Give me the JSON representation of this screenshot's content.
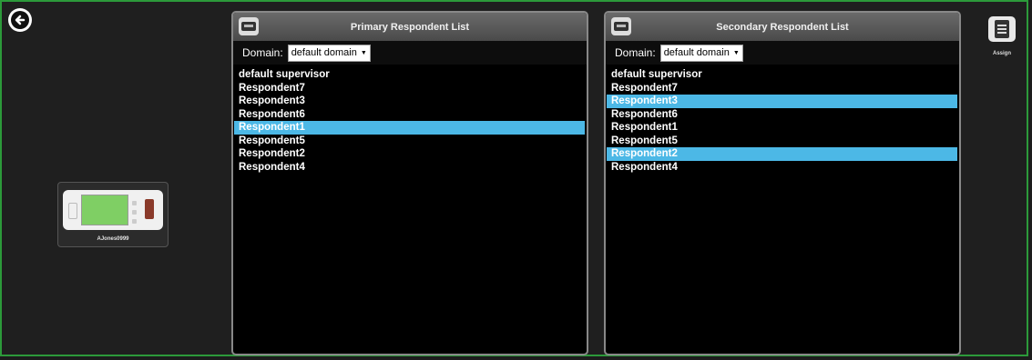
{
  "device": {
    "label": "AJones0999"
  },
  "primary_panel": {
    "title": "Primary Respondent List",
    "domain_label": "Domain:",
    "domain_value": "default domain",
    "items": [
      {
        "label": "default supervisor",
        "selected": false
      },
      {
        "label": "Respondent7",
        "selected": false
      },
      {
        "label": "Respondent3",
        "selected": false
      },
      {
        "label": "Respondent6",
        "selected": false
      },
      {
        "label": "Respondent1",
        "selected": true
      },
      {
        "label": "Respondent5",
        "selected": false
      },
      {
        "label": "Respondent2",
        "selected": false
      },
      {
        "label": "Respondent4",
        "selected": false
      }
    ]
  },
  "secondary_panel": {
    "title": "Secondary Respondent List",
    "domain_label": "Domain:",
    "domain_value": "default domain",
    "items": [
      {
        "label": "default supervisor",
        "selected": false
      },
      {
        "label": "Respondent7",
        "selected": false
      },
      {
        "label": "Respondent3",
        "selected": true
      },
      {
        "label": "Respondent6",
        "selected": false
      },
      {
        "label": "Respondent1",
        "selected": false
      },
      {
        "label": "Respondent5",
        "selected": false
      },
      {
        "label": "Respondent2",
        "selected": true
      },
      {
        "label": "Respondent4",
        "selected": false
      }
    ]
  },
  "assign": {
    "label": "Assign"
  },
  "colors": {
    "selection": "#4cb8e6",
    "border": "#2c9a3a"
  },
  "icons": {
    "back": "back-arrow-icon",
    "assign": "assign-icon",
    "panel": "device-icon"
  }
}
